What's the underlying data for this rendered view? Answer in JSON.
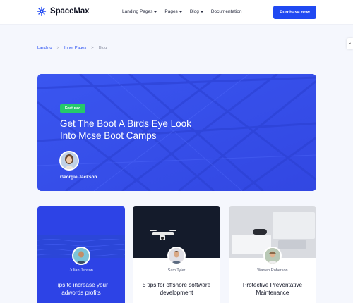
{
  "brand": {
    "name": "SpaceMax"
  },
  "nav": {
    "items": [
      {
        "label": "Landing Pages",
        "has_dropdown": true
      },
      {
        "label": "Pages",
        "has_dropdown": true
      },
      {
        "label": "Blog",
        "has_dropdown": true
      },
      {
        "label": "Documentation",
        "has_dropdown": false
      }
    ],
    "cta_label": "Purchase now"
  },
  "breadcrumb": {
    "items": [
      "Landing",
      "Inner Pages",
      "Blog"
    ],
    "separator": ">"
  },
  "featured": {
    "badge": "Featured",
    "title": "Get The Boot A Birds Eye Look Into Mcse Boot Camps",
    "author": "Georgie Jackson"
  },
  "posts": [
    {
      "author": "Julian Jenson",
      "title": "Tips to increase your adwords profits",
      "date": ""
    },
    {
      "author": "Sam Tyler",
      "title": "5 tips for offshore software development",
      "date": ""
    },
    {
      "author": "Warren Roberson",
      "title": "Protective Preventative Maintenance",
      "date": ""
    }
  ],
  "colors": {
    "accent": "#2049f2",
    "hero_blue": "#3b52ee",
    "badge_green": "#25c96a",
    "background": "#f5f7fd"
  },
  "icons": {
    "logo": "snowflake-icon",
    "side_tab": "settings-tab-icon"
  }
}
